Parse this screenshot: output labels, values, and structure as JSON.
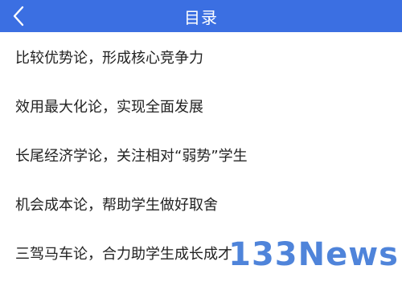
{
  "header": {
    "title": "目录",
    "back_icon": "chevron-left-icon",
    "background": "#3b6fe2"
  },
  "items": [
    {
      "label": "比较优势论，形成核心竞争力"
    },
    {
      "label": "效用最大化论，实现全面发展"
    },
    {
      "label": "长尾经济学论，关注相对“弱势”学生"
    },
    {
      "label": "机会成本论，帮助学生做好取舍"
    },
    {
      "label": "三驾马车论，合力助学生成长成才"
    }
  ],
  "watermark": {
    "text": "133News"
  }
}
